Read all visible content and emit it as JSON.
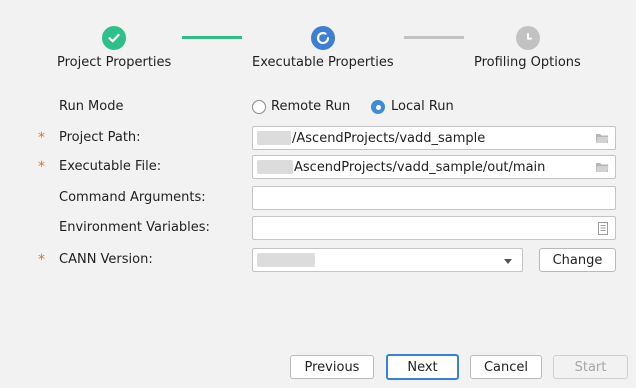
{
  "stepper": {
    "steps": [
      {
        "label": "Project Properties",
        "state": "complete",
        "icon": "check-icon"
      },
      {
        "label": "Executable Properties",
        "state": "active",
        "icon": "progress-icon"
      },
      {
        "label": "Profiling Options",
        "state": "pending",
        "icon": "clock-icon"
      }
    ]
  },
  "form": {
    "run_mode": {
      "label": "Run Mode",
      "options": [
        {
          "label": "Remote Run",
          "selected": false
        },
        {
          "label": "Local Run",
          "selected": true
        }
      ]
    },
    "project_path": {
      "label": "Project Path:",
      "required_mark": "*",
      "value": "/AscendProjects/vadd_sample",
      "icon": "folder-icon"
    },
    "executable_file": {
      "label": "Executable File:",
      "required_mark": "*",
      "value": "AscendProjects/vadd_sample/out/main",
      "icon": "folder-icon"
    },
    "command_arguments": {
      "label": "Command Arguments:",
      "value": ""
    },
    "environment_variables": {
      "label": "Environment Variables:",
      "value": "",
      "icon": "document-icon"
    },
    "cann_version": {
      "label": "CANN Version:",
      "required_mark": "*",
      "value": "",
      "change_label": "Change"
    }
  },
  "footer": {
    "previous": "Previous",
    "next": "Next",
    "cancel": "Cancel",
    "start": "Start"
  },
  "colors": {
    "complete": "#2fbf8a",
    "active": "#3d7fd1",
    "pending": "#c2c2c2",
    "required": "#e0762d"
  }
}
